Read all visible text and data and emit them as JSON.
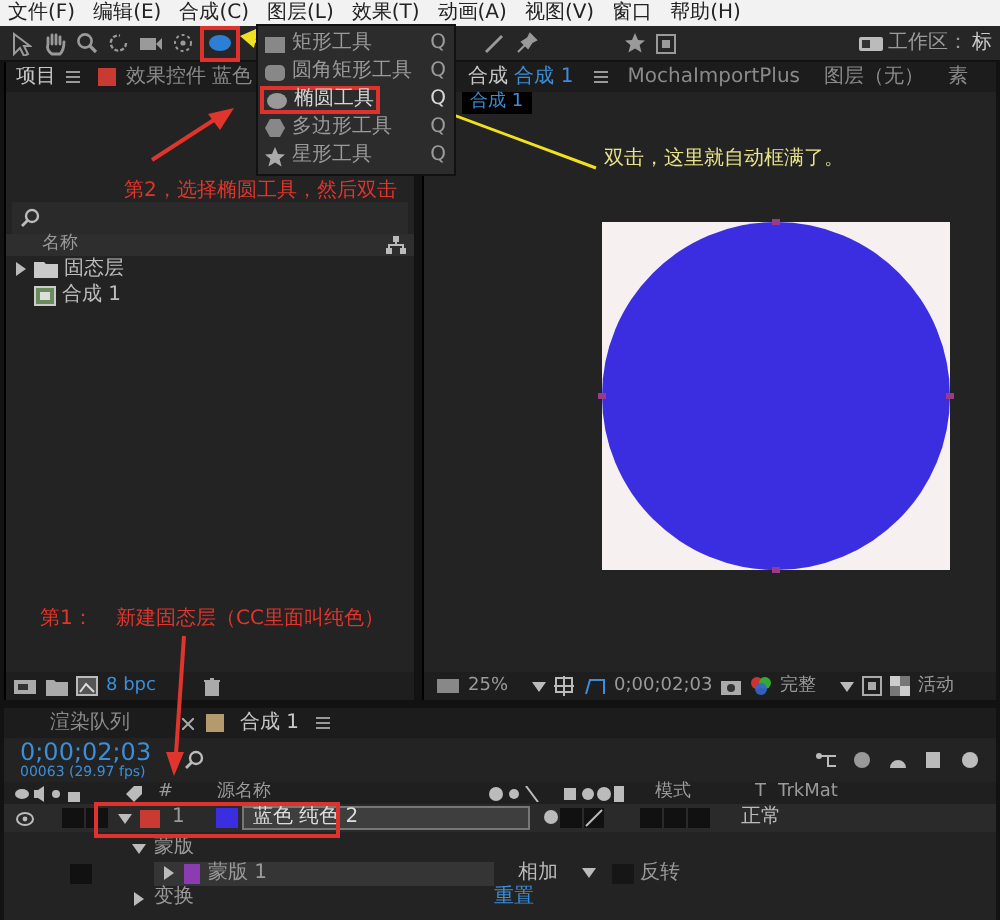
{
  "menu_bar": [
    "文件(F)",
    "编辑(E)",
    "合成(C)",
    "图层(L)",
    "效果(T)",
    "动画(A)",
    "视图(V)",
    "窗口",
    "帮助(H)"
  ],
  "toolbar": {
    "tools": [
      {
        "kind": "select",
        "selected": false
      },
      {
        "kind": "hand",
        "selected": false
      },
      {
        "kind": "zoom",
        "selected": false
      },
      {
        "kind": "rotate",
        "selected": false
      },
      {
        "kind": "camera",
        "selected": false
      },
      {
        "kind": "orbit",
        "selected": false
      },
      {
        "kind": "ellipse",
        "selected": true
      },
      {
        "kind": "pen",
        "selected": false
      },
      {
        "kind": "pin",
        "selected": false
      },
      {
        "kind": "star",
        "selected": false
      },
      {
        "kind": "box",
        "selected": false
      }
    ],
    "workspace_label": "工作区：",
    "workspace_value": "标"
  },
  "tool_menu": [
    {
      "kind": "rect",
      "label": "矩形工具",
      "shortcut": "Q",
      "selected": false
    },
    {
      "kind": "rounded",
      "label": "圆角矩形工具",
      "shortcut": "Q",
      "selected": false
    },
    {
      "kind": "ellipse",
      "label": "椭圆工具",
      "shortcut": "Q",
      "selected": true
    },
    {
      "kind": "polygon",
      "label": "多边形工具",
      "shortcut": "Q",
      "selected": false
    },
    {
      "kind": "star",
      "label": "星形工具",
      "shortcut": "Q",
      "selected": false
    }
  ],
  "project_panel": {
    "tabs": [
      {
        "label": "项目",
        "selected": true
      },
      {
        "label": "效果控件 蓝色",
        "selected": false
      }
    ],
    "column": "名称",
    "items": [
      {
        "kind": "folder",
        "label": "固态层"
      },
      {
        "kind": "comp",
        "label": "合成 1"
      }
    ],
    "bpc": "8 bpc"
  },
  "viewer": {
    "tabs": [
      {
        "prefix": "合成",
        "label": "合成 1",
        "selected": true
      },
      {
        "label": "MochaImportPlus",
        "selected": false
      },
      {
        "label": "图层（无）",
        "selected": false
      },
      {
        "label": "素",
        "selected": false
      }
    ],
    "breadcrumb": "合成 1",
    "zoom": "25%",
    "timecode": "0;00;02;03",
    "resolution": "完整",
    "camera": "活动"
  },
  "timeline": {
    "tabs": [
      {
        "label": "渲染队列",
        "selected": false
      },
      {
        "label": "合成 1",
        "selected": true
      }
    ],
    "timecode": "0;00;02;03",
    "frame_info": "00063 (29.97 fps)",
    "columns": {
      "number": "#",
      "source": "源名称",
      "mode": "模式",
      "t": "T",
      "trkmat": "TrkMat"
    },
    "layers": [
      {
        "index": "1",
        "name": "蓝色 纯色 2",
        "color": "#c83a32",
        "solid": {
          "color": "#3a2ee0"
        },
        "mode": "正常",
        "expanded": true,
        "children": [
          {
            "label": "蒙版",
            "expanded": true,
            "children": [
              {
                "name": "蒙版 1",
                "color": "#8a3cb0",
                "mode": "相加",
                "invert": "反转",
                "inverted": false
              }
            ]
          },
          {
            "label": "变换",
            "expanded": false,
            "reset": "重置"
          }
        ]
      }
    ]
  },
  "annotations": [
    {
      "kind": "red",
      "text": "第2，选择椭圆工具，然后双击"
    },
    {
      "kind": "yellow",
      "text": "双击，这里就自动框满了。"
    },
    {
      "kind": "red",
      "text": "第1："
    },
    {
      "kind": "red",
      "text": "新建固态层（CC里面叫纯色）"
    }
  ]
}
